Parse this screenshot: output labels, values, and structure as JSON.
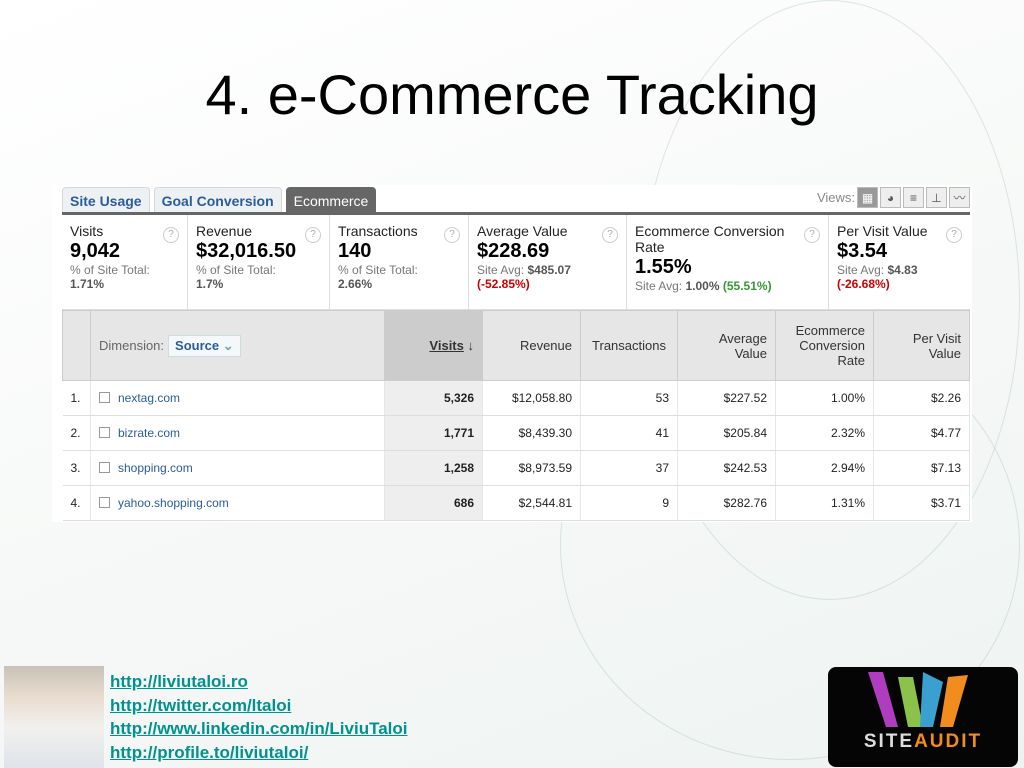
{
  "title": "4. e-Commerce Tracking",
  "tabs": [
    "Site Usage",
    "Goal Conversion",
    "Ecommerce"
  ],
  "views_label": "Views:",
  "metrics": [
    {
      "label": "Visits",
      "value": "9,042",
      "sub": "% of Site Total:",
      "sub_value": "1.71%"
    },
    {
      "label": "Revenue",
      "value": "$32,016.50",
      "sub": "% of Site Total:",
      "sub_value": "1.7%"
    },
    {
      "label": "Transactions",
      "value": "140",
      "sub": "% of Site Total:",
      "sub_value": "2.66%"
    },
    {
      "label": "Average Value",
      "value": "$228.69",
      "sub": "Site Avg:",
      "sub_value": "$485.07",
      "delta": "(-52.85%)"
    },
    {
      "label": "Ecommerce Conversion Rate",
      "value": "1.55%",
      "sub": "Site Avg:",
      "sub_value": "1.00%",
      "delta": "(55.51%)"
    },
    {
      "label": "Per Visit Value",
      "value": "$3.54",
      "sub": "Site Avg:",
      "sub_value": "$4.83",
      "delta": "(-26.68%)"
    }
  ],
  "table": {
    "dimension_label": "Dimension:",
    "dimension_value": "Source",
    "headers": [
      "Visits",
      "Revenue",
      "Transactions",
      "Average Value",
      "Ecommerce Conversion Rate",
      "Per Visit Value"
    ],
    "rows": [
      {
        "n": "1.",
        "source": "nextag.com",
        "visits": "5,326",
        "revenue": "$12,058.80",
        "tx": "53",
        "avg": "$227.52",
        "ecr": "1.00%",
        "pvv": "$2.26"
      },
      {
        "n": "2.",
        "source": "bizrate.com",
        "visits": "1,771",
        "revenue": "$8,439.30",
        "tx": "41",
        "avg": "$205.84",
        "ecr": "2.32%",
        "pvv": "$4.77"
      },
      {
        "n": "3.",
        "source": "shopping.com",
        "visits": "1,258",
        "revenue": "$8,973.59",
        "tx": "37",
        "avg": "$242.53",
        "ecr": "2.94%",
        "pvv": "$7.13"
      },
      {
        "n": "4.",
        "source": "yahoo.shopping.com",
        "visits": "686",
        "revenue": "$2,544.81",
        "tx": "9",
        "avg": "$282.76",
        "ecr": "1.31%",
        "pvv": "$3.71"
      }
    ]
  },
  "links": [
    "http://liviutaloi.ro",
    "http://twitter.com/ltaloi",
    "http://www.linkedin.com/in/LiviuTaloi",
    "http://profile.to/liviutaloi/"
  ],
  "logo": {
    "a": "SITE",
    "b": "AUDIT"
  }
}
